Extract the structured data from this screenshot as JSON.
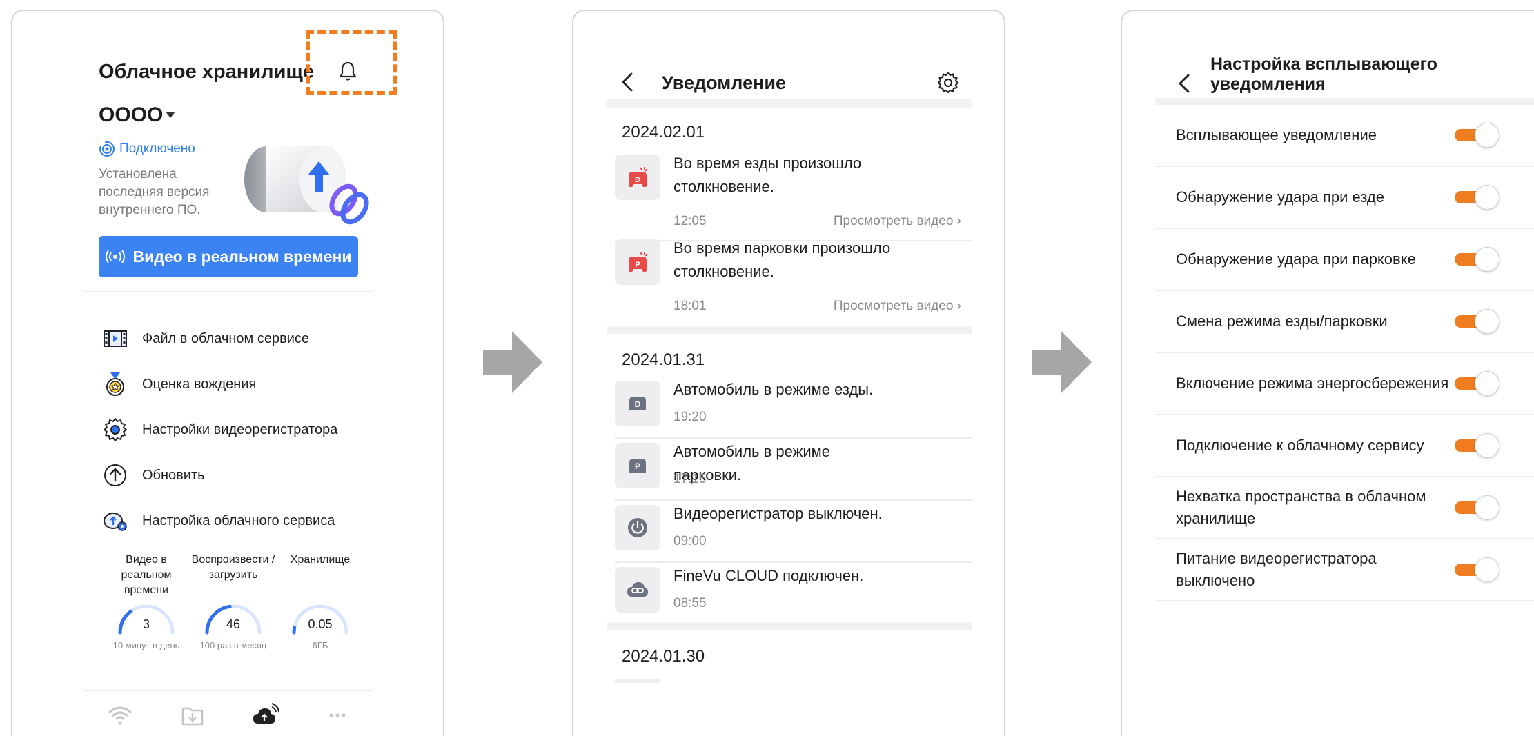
{
  "screen1": {
    "title": "Облачное хранилище",
    "device_name": "OOOO",
    "status": "Подключено",
    "firmware_status": "Установлена последняя версия внутреннего ПО.",
    "live_button": "Видео в реальном времени",
    "menu": [
      {
        "label": "Файл в облачном сервисе",
        "icon": "film-icon"
      },
      {
        "label": "Оценка вождения",
        "icon": "medal-icon"
      },
      {
        "label": "Настройки видеорегистратора",
        "icon": "gear-icon"
      },
      {
        "label": "Обновить",
        "icon": "upload-arrow-icon"
      },
      {
        "label": "Настройка облачного сервиса",
        "icon": "cloud-settings-icon"
      }
    ],
    "stats": [
      {
        "label": "Видео в реальном времени",
        "value": "3",
        "sub": "10 минут в день",
        "fraction": 0.3
      },
      {
        "label": "Воспроизвести /загрузить",
        "value": "46",
        "sub": "100 раз в месяц",
        "fraction": 0.46
      },
      {
        "label": "Хранилище",
        "value": "0.05",
        "sub": "6ГБ",
        "fraction": 0.02
      }
    ],
    "tabs": [
      "wifi-icon",
      "download-folder-icon",
      "cloud-live-icon",
      "more-icon"
    ],
    "highlight_color": "#f07d1f",
    "accent_color": "#3b82f2"
  },
  "screen2": {
    "title": "Уведомление",
    "groups": [
      {
        "date": "2024.02.01",
        "items": [
          {
            "text": "Во время езды произошло столкновение.",
            "time": "12:05",
            "link": "Просмотреть видео",
            "icon": "drive-impact-icon"
          },
          {
            "text": "Во время парковки произошло столкновение.",
            "time": "18:01",
            "link": "Просмотреть видео",
            "icon": "parking-impact-icon"
          }
        ]
      },
      {
        "date": "2024.01.31",
        "items": [
          {
            "text": "Автомобиль в режиме езды.",
            "time": "19:20",
            "icon": "drive-mode-icon"
          },
          {
            "text": "Автомобиль в режиме парковки.",
            "time": "17:15",
            "icon": "parking-mode-icon"
          },
          {
            "text": "Видеорегистратор выключен.",
            "time": "09:00",
            "icon": "power-icon"
          },
          {
            "text": "FineVu CLOUD подключен.",
            "time": "08:55",
            "icon": "cloud-link-icon"
          }
        ]
      },
      {
        "date": "2024.01.30",
        "items": []
      }
    ]
  },
  "screen3": {
    "title": "Настройка всплывающего уведомления",
    "settings": [
      {
        "label": "Всплывающее уведомление",
        "on": true
      },
      {
        "label": "Обнаружение удара при езде",
        "on": true
      },
      {
        "label": "Обнаружение удара при парковке",
        "on": true
      },
      {
        "label": "Смена режима езды/парковки",
        "on": true
      },
      {
        "label": "Включение режима энергосбережения",
        "on": true
      },
      {
        "label": "Подключение к облачному сервису",
        "on": true
      },
      {
        "label": "Нехватка пространства в облачном хранилище",
        "on": true
      },
      {
        "label": "Питание видеорегистратора выключено",
        "on": true
      }
    ],
    "toggle_color": "#f07d1f"
  }
}
